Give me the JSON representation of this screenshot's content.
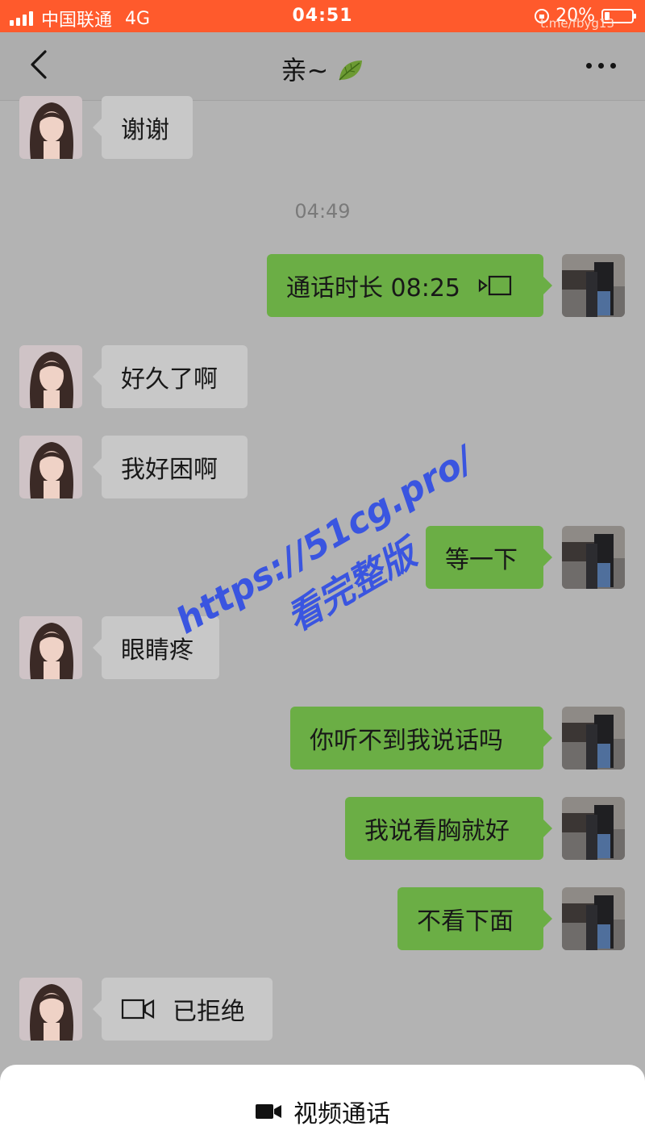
{
  "status_bar": {
    "carrier": "中国联通",
    "network": "4G",
    "time": "04:51",
    "battery": "20%",
    "battery_level": 0.2,
    "corner_text": "t.me/fbyg13",
    "bg_color": "#ff5a2c"
  },
  "nav": {
    "back_icon": "chevron-left-icon",
    "title": "亲~",
    "title_icon": "leaf-emoji",
    "more_icon": "more-dots-icon"
  },
  "chat": {
    "timestamp": "04:49",
    "messages": [
      {
        "side": "in",
        "text": "谢谢"
      },
      {
        "side": "out",
        "text": "通话时长 08:25",
        "icon": "video-call-icon"
      },
      {
        "side": "in",
        "text": "好久了啊"
      },
      {
        "side": "in",
        "text": "我好困啊"
      },
      {
        "side": "out",
        "text": "等一下"
      },
      {
        "side": "in",
        "text": "眼睛疼"
      },
      {
        "side": "out",
        "text": "你听不到我说话吗"
      },
      {
        "side": "out",
        "text": "我说看胸就好"
      },
      {
        "side": "out",
        "text": "不看下面"
      },
      {
        "side": "in",
        "text": "已拒绝",
        "icon": "video-camera-icon"
      }
    ]
  },
  "watermark": {
    "line1": "https://51cg.pro/",
    "line2": "看完整版",
    "color": "#3a55e0"
  },
  "bottom_sheet": {
    "icon": "video-camera-icon",
    "label": "视频通话"
  },
  "colors": {
    "outgoing_bubble": "#6bae45",
    "incoming_bubble": "#c8c8c8",
    "chat_background": "#b3b3b3"
  }
}
